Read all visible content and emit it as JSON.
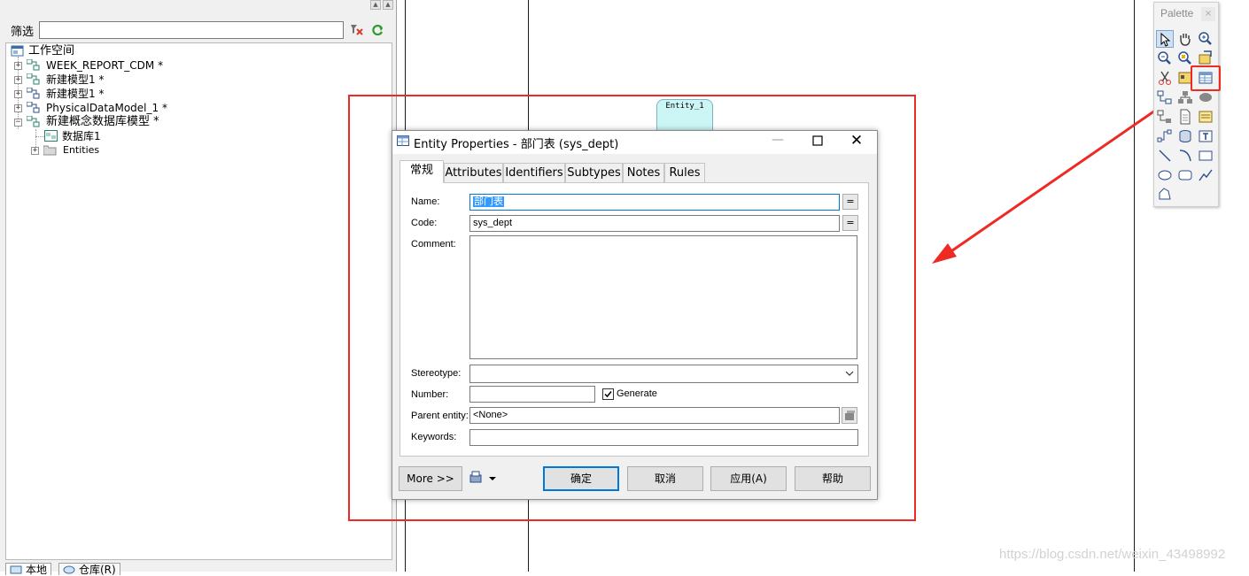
{
  "left_panel": {
    "filter_label": "筛选",
    "filter_value": "",
    "tree": [
      {
        "label": "工作空间"
      },
      {
        "label": "WEEK_REPORT_CDM *"
      },
      {
        "label": "新建模型1 *"
      },
      {
        "label": "新建模型1 *"
      },
      {
        "label": "PhysicalDataModel_1 *"
      },
      {
        "label": "新建概念数据库模型 *"
      },
      {
        "label": "数据库1"
      },
      {
        "label": "Entities"
      }
    ],
    "bottom_tabs": [
      "本地",
      "仓库(R)"
    ]
  },
  "canvas": {
    "entity_title": "Entity_1",
    "watermark": "https://blog.csdn.net/weixin_43498992"
  },
  "palette": {
    "title": "Palette",
    "close": "×",
    "tools": [
      "pointer-icon",
      "hand-icon",
      "zoom-in-icon",
      "zoom-out-icon",
      "zoom-fit-icon",
      "open-package-icon",
      "cut-icon",
      "properties-icon",
      "entity-tool-icon",
      "inheritance-icon",
      "hierarchy-icon",
      "association-icon",
      "link-icon",
      "file-icon",
      "note-icon",
      "relationship-icon",
      "database-icon",
      "text-icon",
      "line-icon",
      "arc-icon",
      "rectangle-icon",
      "ellipse-icon",
      "rounded-rectangle-icon",
      "polyline-icon",
      "polygon-icon"
    ]
  },
  "dialog": {
    "title": "Entity Properties - 部门表 (sys_dept)",
    "tabs": [
      "常规",
      "Attributes",
      "Identifiers",
      "Subtypes",
      "Notes",
      "Rules"
    ],
    "active_tab": "常规",
    "fields": {
      "name_label": "Name:",
      "name_value": "部门表",
      "code_label": "Code:",
      "code_value": "sys_dept",
      "comment_label": "Comment:",
      "comment_value": "",
      "stereotype_label": "Stereotype:",
      "stereotype_value": "",
      "number_label": "Number:",
      "number_value": "",
      "generate_label": "Generate",
      "generate_checked": true,
      "parent_label": "Parent entity:",
      "parent_value": "<None>",
      "keywords_label": "Keywords:",
      "keywords_value": "",
      "eq": "="
    },
    "buttons": {
      "more": "More >>",
      "ok": "确定",
      "cancel": "取消",
      "apply": "应用(A)",
      "help": "帮助"
    }
  }
}
